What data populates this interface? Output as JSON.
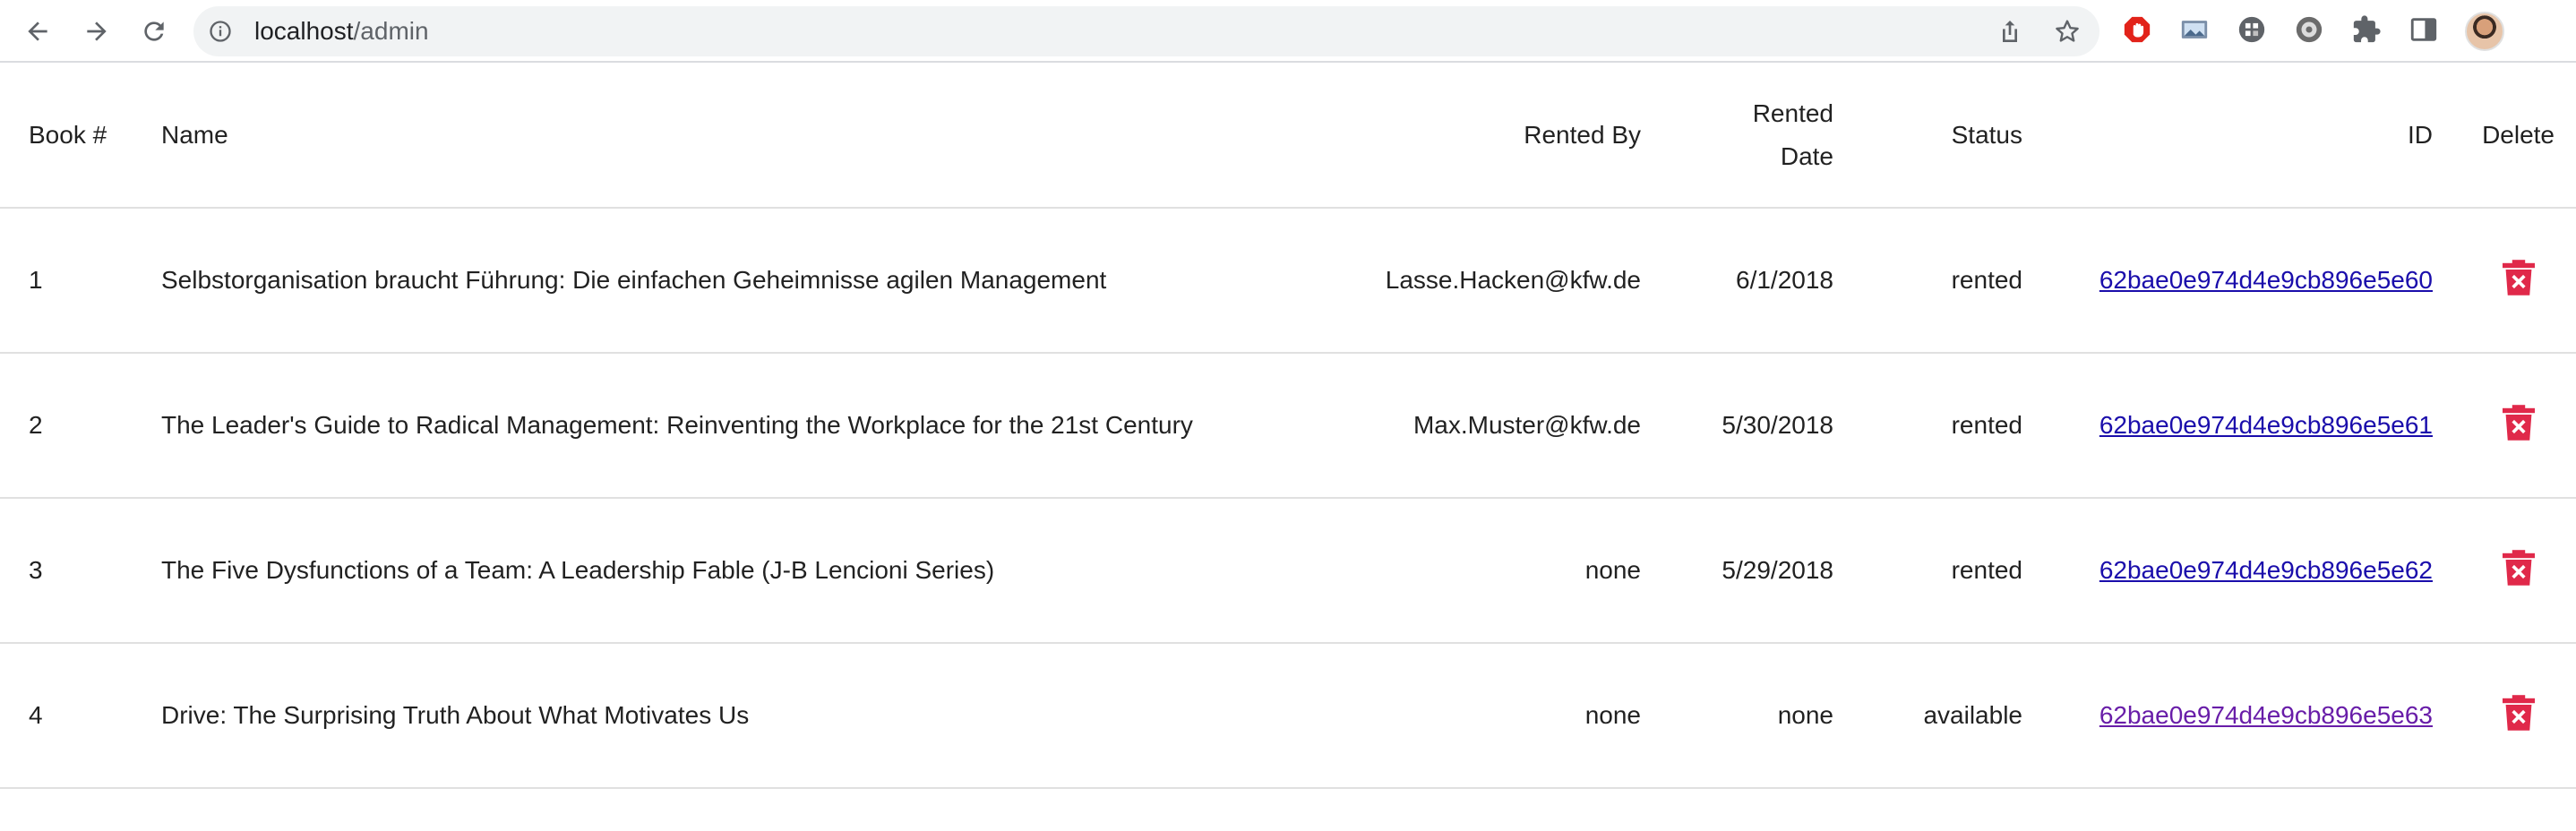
{
  "browser": {
    "url_host": "localhost",
    "url_path": "/admin"
  },
  "table": {
    "headers": {
      "book_num": "Book #",
      "name": "Name",
      "rented_by": "Rented By",
      "rented_date": "Rented Date",
      "status": "Status",
      "id": "ID",
      "delete": "Delete"
    },
    "rows": [
      {
        "num": "1",
        "name": "Selbstorganisation braucht Führung: Die einfachen Geheimnisse agilen Management",
        "rented_by": "Lasse.Hacken@kfw.de",
        "rented_date": "6/1/2018",
        "status": "rented",
        "id": "62bae0e974d4e9cb896e5e60"
      },
      {
        "num": "2",
        "name": "The Leader's Guide to Radical Management: Reinventing the Workplace for the 21st Century",
        "rented_by": "Max.Muster@kfw.de",
        "rented_date": "5/30/2018",
        "status": "rented",
        "id": "62bae0e974d4e9cb896e5e61"
      },
      {
        "num": "3",
        "name": "The Five Dysfunctions of a Team: A Leadership Fable (J-B Lencioni Series)",
        "rented_by": "none",
        "rented_date": "5/29/2018",
        "status": "rented",
        "id": "62bae0e974d4e9cb896e5e62"
      },
      {
        "num": "4",
        "name": "Drive: The Surprising Truth About What Motivates Us",
        "rented_by": "none",
        "rented_date": "none",
        "status": "available",
        "id": "62bae0e974d4e9cb896e5e63"
      }
    ]
  },
  "colors": {
    "delete_icon": "#e0294a",
    "link": "#1a0dab",
    "link_visited": "#681da8"
  }
}
